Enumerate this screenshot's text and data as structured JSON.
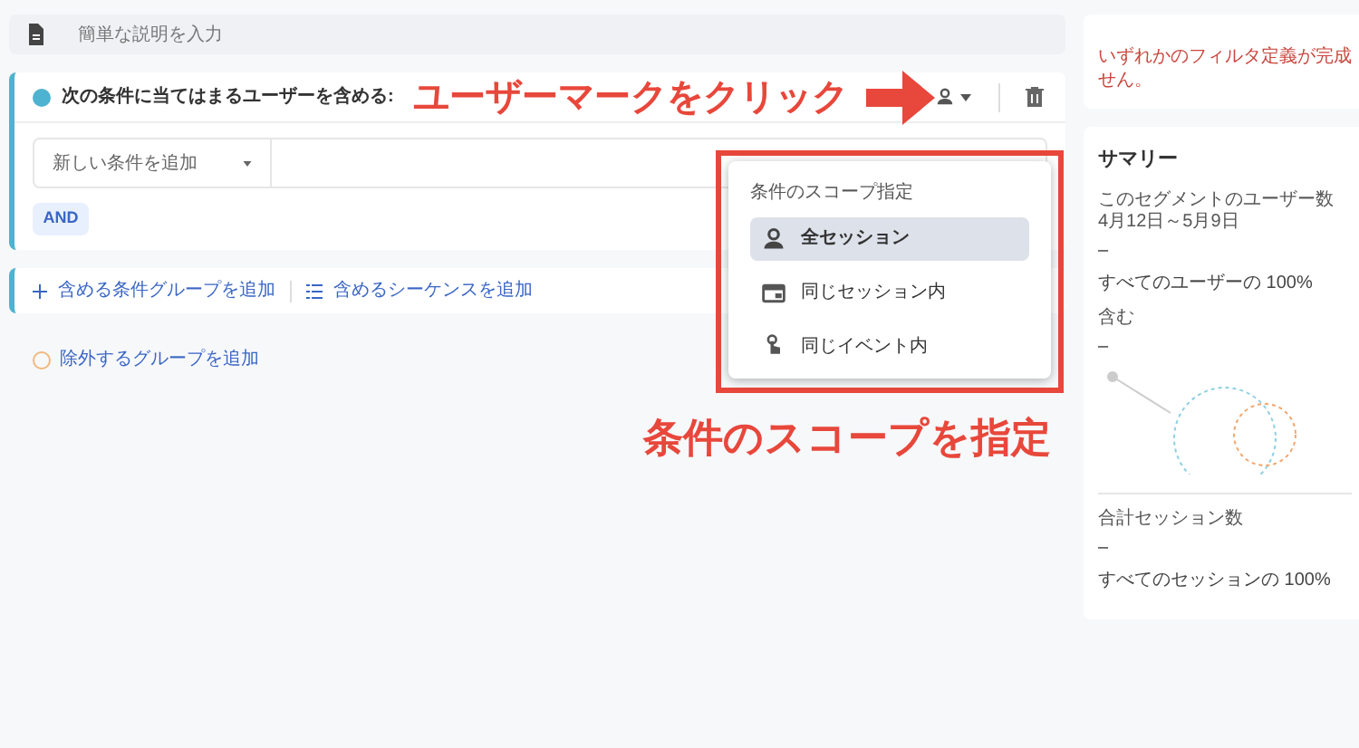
{
  "description_field": {
    "placeholder": "簡単な説明を入力"
  },
  "include_group": {
    "title": "次の条件に当てはまるユーザーを含める:",
    "condition": {
      "placeholder": "新しい条件を追加"
    },
    "and_button": "AND"
  },
  "add_actions": [
    {
      "kind": "plus",
      "label": "含める条件グループを追加"
    },
    {
      "kind": "list",
      "label": "含めるシーケンスを追加"
    }
  ],
  "exclude_action": {
    "label": "除外するグループを追加"
  },
  "scope_menu": {
    "title": "条件のスコープ指定",
    "items": [
      {
        "kind": "user",
        "label": "全セッション",
        "selected": true
      },
      {
        "kind": "session",
        "label": "同じセッション内",
        "selected": false
      },
      {
        "kind": "event",
        "label": "同じイベント内",
        "selected": false
      }
    ]
  },
  "annotations": [
    {
      "text": "ユーザーマークをクリック"
    },
    {
      "text": "条件のスコープを指定"
    }
  ],
  "warning": {
    "lines": [
      "いずれかのフィルタ定義が完成",
      "せん。"
    ]
  },
  "summary": {
    "title": "サマリー",
    "sections": [
      {
        "label": "このセグメントのユーザー数",
        "sublabel": "4月12日～5月9日",
        "value": "–",
        "share": "すべてのユーザーの 100%"
      },
      {
        "label": "含む",
        "value": "–",
        "kind": "venn"
      },
      {
        "label": "合計セッション数",
        "value": "–",
        "share": "すべてのセッションの 100%"
      }
    ]
  }
}
